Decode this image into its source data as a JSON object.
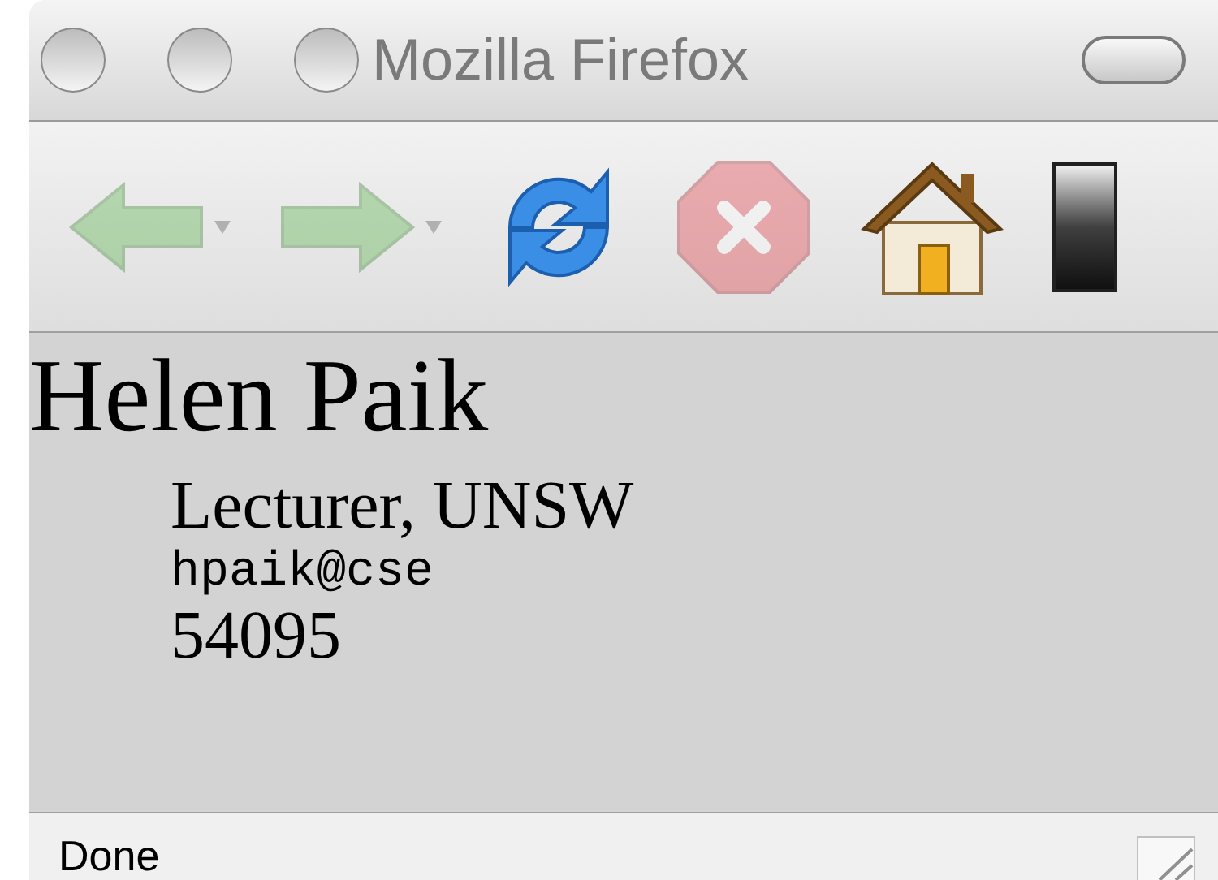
{
  "window": {
    "title": "Mozilla Firefox"
  },
  "toolbar": [
    {
      "kind": "back",
      "disabled": true,
      "has_menu": true
    },
    {
      "kind": "forward",
      "disabled": true,
      "has_menu": true
    },
    {
      "kind": "reload",
      "disabled": false,
      "has_menu": false
    },
    {
      "kind": "stop",
      "disabled": true,
      "has_menu": false
    },
    {
      "kind": "home",
      "disabled": false,
      "has_menu": false
    }
  ],
  "content": [
    {
      "kind": "name",
      "text": "Helen Paik"
    },
    {
      "kind": "title",
      "text": "Lecturer, UNSW"
    },
    {
      "kind": "email",
      "text": "hpaik@cse"
    },
    {
      "kind": "phone",
      "text": "54095"
    }
  ],
  "status_bar": {
    "text": "Done"
  }
}
